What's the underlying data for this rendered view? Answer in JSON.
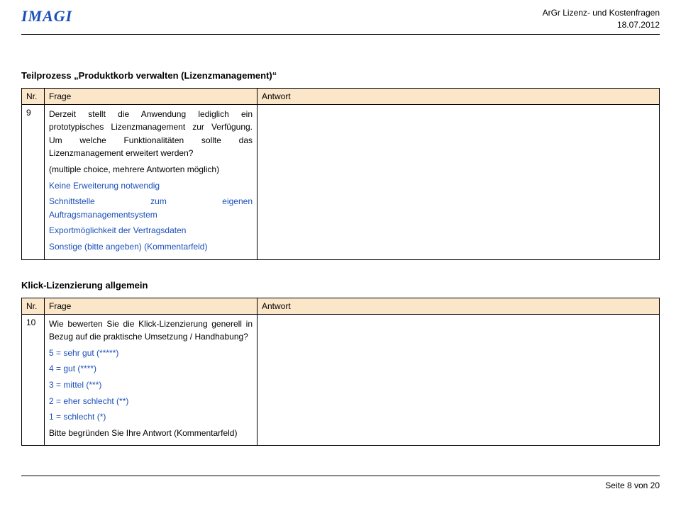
{
  "header": {
    "logo": "IMAGI",
    "title": "ArGr Lizenz- und Kostenfragen",
    "date": "18.07.2012"
  },
  "section1": {
    "title": "Teilprozess „Produktkorb verwalten (Lizenzmanagement)“",
    "cols": {
      "nr": "Nr.",
      "frage": "Frage",
      "antwort": "Antwort"
    },
    "row": {
      "nr": "9",
      "q_p1": "Derzeit stellt die Anwendung lediglich ein prototypisches Lizenzmanagement zur Verfügung. Um welche Funktionalitäten sollte das Lizenzmanagement erweitert werden?",
      "q_note": "(multiple choice, mehrere Antworten möglich)",
      "opt1": "Keine Erweiterung notwendig",
      "opt2": "Schnittstelle zum eigenen Auftragsmanagementsystem",
      "opt3": "Exportmöglichkeit der Vertragsdaten",
      "opt4": "Sonstige (bitte angeben) (Kommentarfeld)"
    }
  },
  "section2": {
    "title": "Klick-Lizenzierung allgemein",
    "cols": {
      "nr": "Nr.",
      "frage": "Frage",
      "antwort": "Antwort"
    },
    "row": {
      "nr": "10",
      "q_p1": "Wie bewerten Sie die Klick-Lizenzierung generell in Bezug auf die praktische Umsetzung / Handhabung?",
      "s5": "5 = sehr gut (*****)",
      "s4": "4 = gut (****)",
      "s3": "3 = mittel (***)",
      "s2": "2 = eher schlecht (**)",
      "s1": "1 = schlecht (*)",
      "q_note": "Bitte begründen Sie Ihre Antwort (Kommentarfeld)"
    }
  },
  "footer": {
    "page": "Seite 8 von 20"
  }
}
